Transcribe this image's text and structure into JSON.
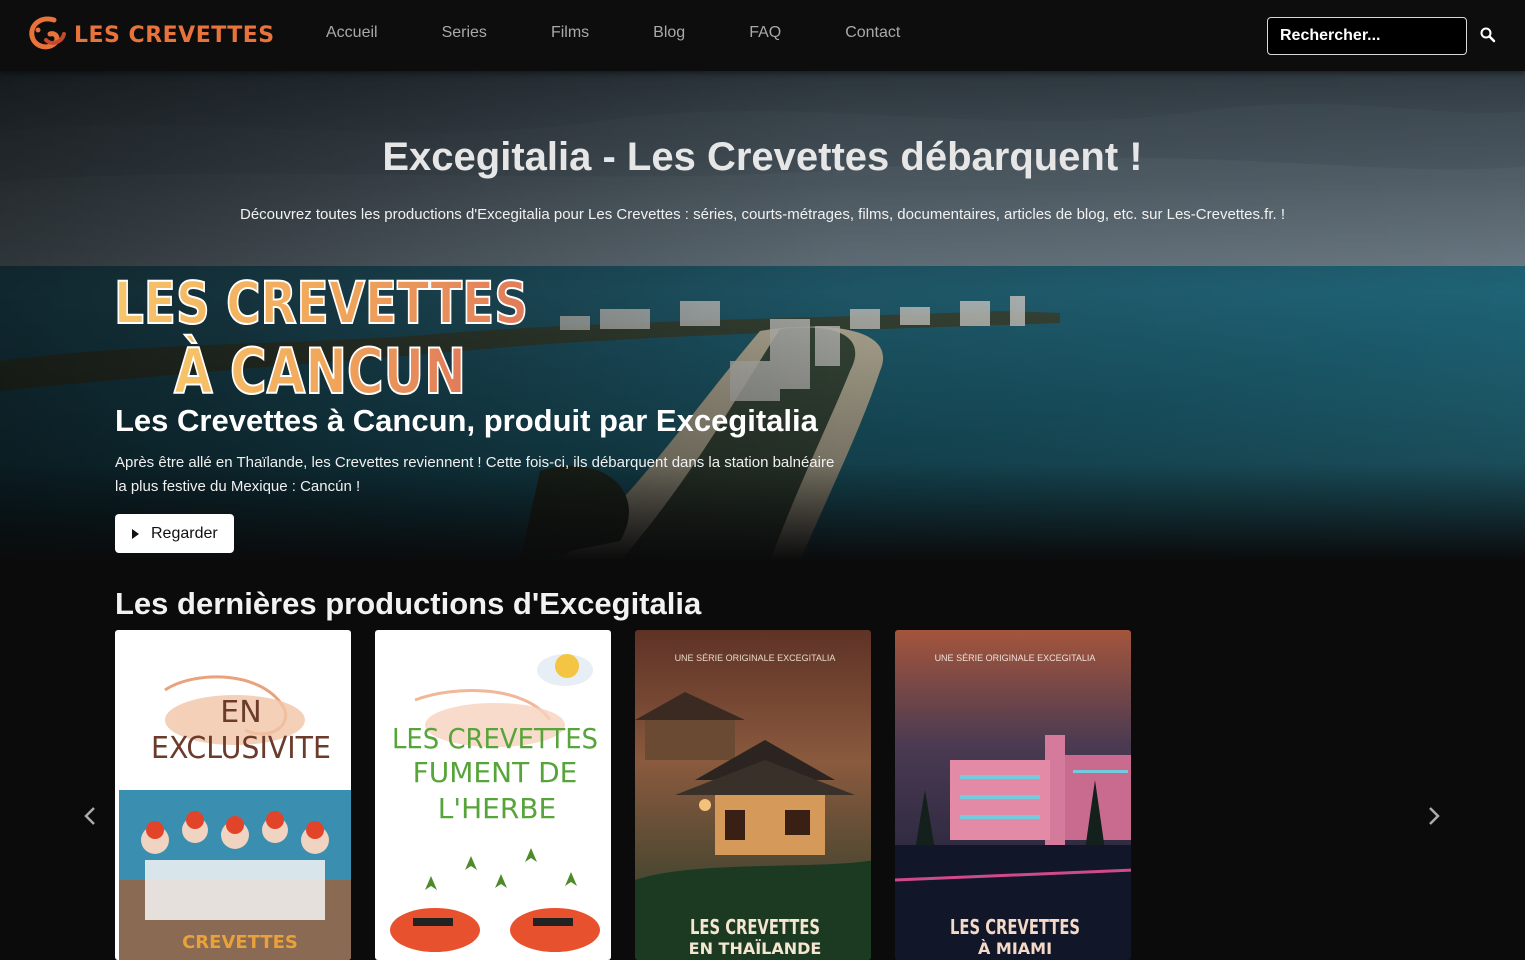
{
  "brand": {
    "name": "LES CREVETTES",
    "accent": "#e8743b"
  },
  "nav": {
    "items": [
      "Accueil",
      "Series",
      "Films",
      "Blog",
      "FAQ",
      "Contact"
    ],
    "search_placeholder": "Rechercher..."
  },
  "hero": {
    "title": "Excegitalia - Les Crevettes débarquent !",
    "subtitle": "Découvrez toutes les productions d'Excegitalia pour Les Crevettes : séries, courts-métrages, films, documentaires, articles de blog, etc. sur Les-Crevettes.fr. !",
    "featured": {
      "logo_line1": "LES CREVETTES",
      "logo_line2": "À CANCUN",
      "title": "Les Crevettes à Cancun, produit par Excegitalia",
      "description": "Après être allé en Thaïlande, les Crevettes reviennent ! Cette fois-ci, ils débarquent dans la station balnéaire la plus festive du Mexique : Cancún !",
      "button": "Regarder"
    }
  },
  "latest": {
    "title": "Les dernières productions d'Excegitalia",
    "cards": [
      {
        "line1": "EN",
        "line2": "EXCLUSIVITE",
        "bottom": "CREVETTES"
      },
      {
        "line1": "LES CREVETTES",
        "line2": "FUMENT DE",
        "line3": "L'HERBE"
      },
      {
        "tag": "UNE SÉRIE ORIGINALE EXCEGITALIA",
        "line1": "LES CREVETTES",
        "line2": "EN THAÏLANDE"
      },
      {
        "tag": "UNE SÉRIE ORIGINALE EXCEGITALIA",
        "line1": "LES CREVETTES",
        "line2": "À MIAMI"
      }
    ]
  }
}
